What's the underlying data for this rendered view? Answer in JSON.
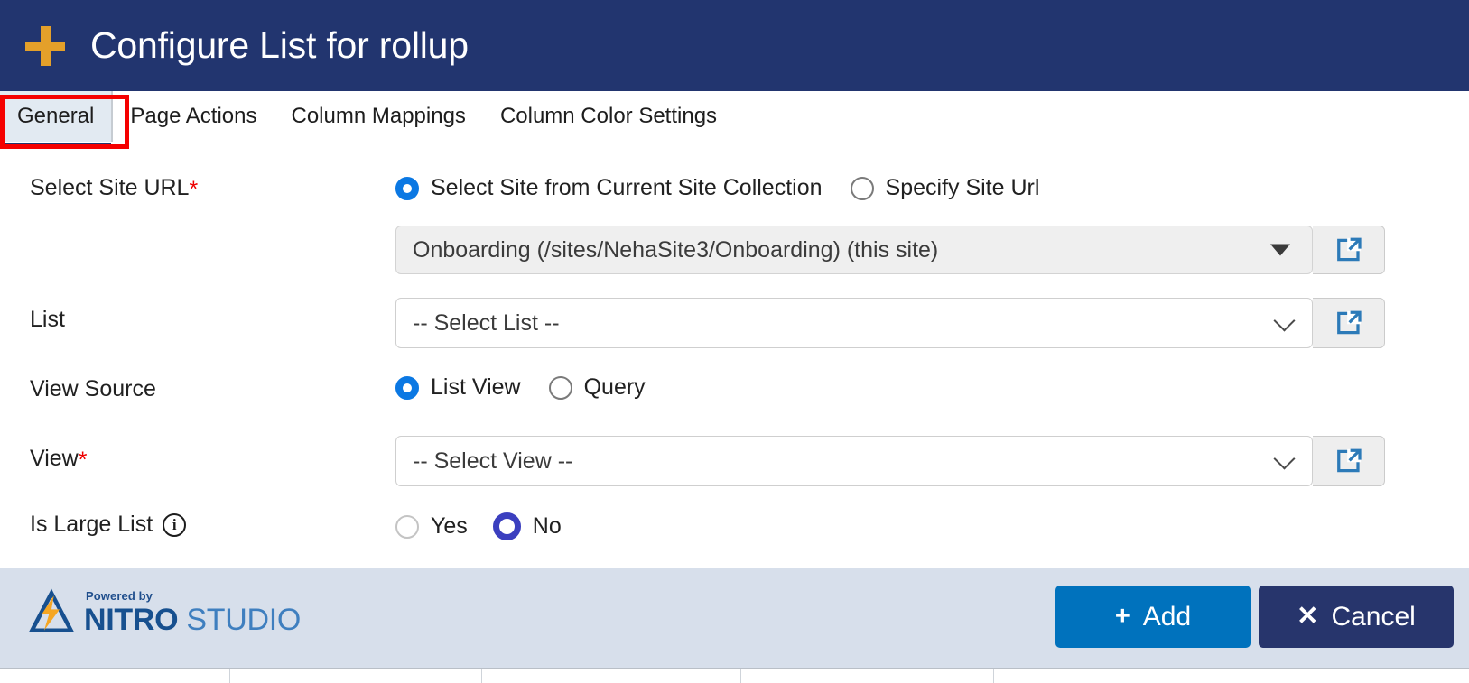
{
  "header": {
    "title": "Configure List for rollup",
    "plus_icon": "plus-icon",
    "bg_color": "#22356f",
    "icon_color": "#e4a02a"
  },
  "tabs": {
    "items": [
      {
        "label": "General",
        "active": true
      },
      {
        "label": "Page Actions",
        "active": false
      },
      {
        "label": "Column Mappings",
        "active": false
      },
      {
        "label": "Column Color Settings",
        "active": false
      }
    ],
    "highlight_color": "#f50000",
    "active_underline_color": "#22356f"
  },
  "form": {
    "site_url": {
      "label": "Select Site URL",
      "required_marker": "*",
      "options": [
        {
          "label": "Select Site from Current Site Collection",
          "selected": true
        },
        {
          "label": "Specify Site Url",
          "selected": false
        }
      ],
      "selected_site": "Onboarding (/sites/NehaSite3/Onboarding) (this site)",
      "open_icon": "external-link-icon",
      "caret_icon": "caret-down-icon"
    },
    "list": {
      "label": "List",
      "value": "-- Select List --",
      "open_icon": "external-link-icon",
      "caret_icon": "chevron-down-icon"
    },
    "view_source": {
      "label": "View Source",
      "options": [
        {
          "label": "List View",
          "selected": true
        },
        {
          "label": "Query",
          "selected": false
        }
      ]
    },
    "view": {
      "label": "View",
      "required_marker": "*",
      "value": "-- Select View --",
      "open_icon": "external-link-icon",
      "caret_icon": "chevron-down-icon"
    },
    "is_large_list": {
      "label": "Is Large List",
      "info_icon": "info-icon",
      "info_glyph": "i",
      "options": [
        {
          "label": "Yes",
          "selected": false
        },
        {
          "label": "No",
          "selected": true
        }
      ],
      "selected_color": "#3b3fbf"
    }
  },
  "footer": {
    "logo": {
      "powered_by": "Powered by",
      "brand_bold": "NITRO",
      "brand_light": " STUDIO",
      "mark_icon": "nitro-triangle-bolt-logo"
    },
    "buttons": [
      {
        "label": "Add",
        "icon": "plus-icon",
        "glyph": "+",
        "color": "#0072bd"
      },
      {
        "label": "Cancel",
        "icon": "close-icon",
        "glyph": "✕",
        "color": "#27356c"
      }
    ]
  }
}
